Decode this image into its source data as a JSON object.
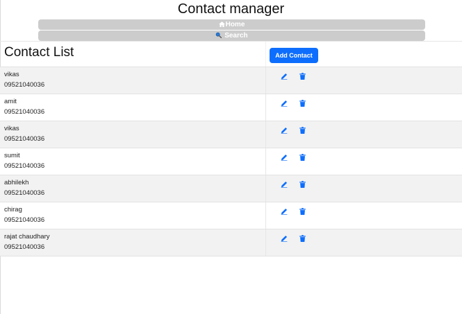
{
  "app": {
    "title": "Contact manager"
  },
  "nav": {
    "home_label": "Home",
    "search_label": "Search",
    "home_icon": "home-icon",
    "search_icon": "search-icon"
  },
  "list": {
    "title": "Contact List",
    "add_button": "Add Contact",
    "edit_icon": "pencil-icon",
    "delete_icon": "trash-icon"
  },
  "contacts": [
    {
      "name": "vikas",
      "phone": "09521040036"
    },
    {
      "name": "amit",
      "phone": "09521040036"
    },
    {
      "name": "vikas",
      "phone": "09521040036"
    },
    {
      "name": "sumit",
      "phone": "09521040036"
    },
    {
      "name": "abhilekh",
      "phone": "09521040036"
    },
    {
      "name": "chirag",
      "phone": "09521040036"
    },
    {
      "name": "rajat chaudhary",
      "phone": "09521040036"
    }
  ],
  "colors": {
    "primary": "#0d6efd",
    "nav_button": "#cccccc",
    "row_stripe": "#f2f2f2"
  }
}
